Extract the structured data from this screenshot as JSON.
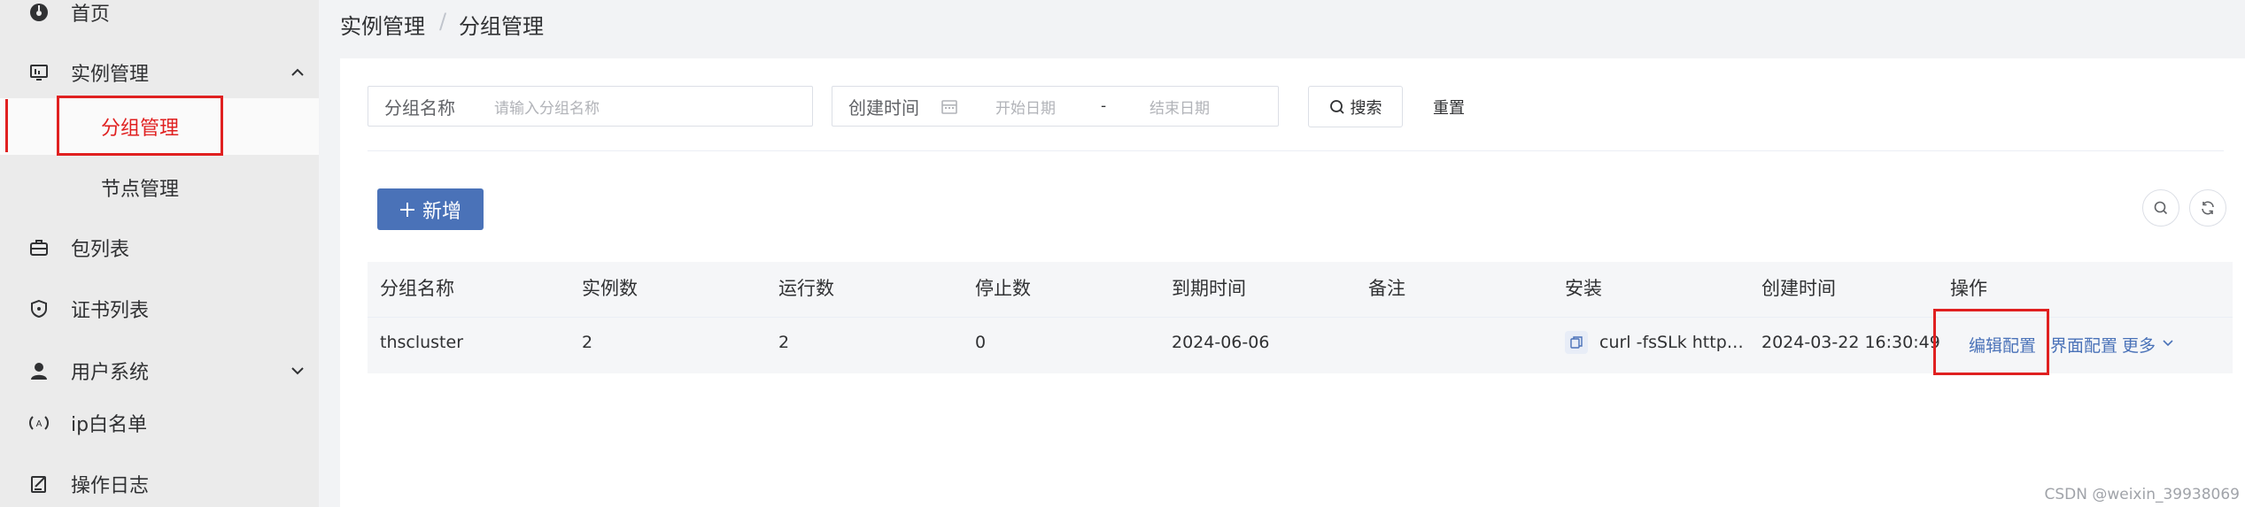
{
  "sidebar": {
    "items": [
      {
        "label": "首页",
        "icon": "dashboard-icon"
      },
      {
        "label": "实例管理",
        "icon": "monitor-icon",
        "expanded": true,
        "children": [
          {
            "label": "分组管理",
            "active": true
          },
          {
            "label": "节点管理"
          }
        ]
      },
      {
        "label": "包列表",
        "icon": "package-icon"
      },
      {
        "label": "证书列表",
        "icon": "shield-icon"
      },
      {
        "label": "用户系统",
        "icon": "user-icon",
        "expanded": false
      },
      {
        "label": "ip白名单",
        "icon": "broadcast-icon"
      },
      {
        "label": "操作日志",
        "icon": "log-icon"
      }
    ]
  },
  "breadcrumb": {
    "parent": "实例管理",
    "separator": "/",
    "current": "分组管理"
  },
  "filters": {
    "group_name_label": "分组名称",
    "group_name_placeholder": "请输入分组名称",
    "created_label": "创建时间",
    "start_placeholder": "开始日期",
    "range_sep": "-",
    "end_placeholder": "结束日期",
    "search_label": "搜索",
    "reset_label": "重置"
  },
  "toolbar": {
    "add_label": "新增"
  },
  "table": {
    "columns": [
      "分组名称",
      "实例数",
      "运行数",
      "停止数",
      "到期时间",
      "备注",
      "安装",
      "创建时间",
      "操作"
    ],
    "rows": [
      {
        "name": "thscluster",
        "instances": "2",
        "running": "2",
        "stopped": "0",
        "expire": "2024-06-06",
        "note": "",
        "install": "curl -fsSLk http…",
        "created": "2024-03-22 16:30:49"
      }
    ],
    "actions": {
      "edit_config": "编辑配置",
      "ui_config": "界面配置",
      "more": "更多"
    }
  },
  "watermark": "CSDN @weixin_39938069",
  "colors": {
    "accent": "#4a72b8",
    "highlight": "#e02020"
  }
}
